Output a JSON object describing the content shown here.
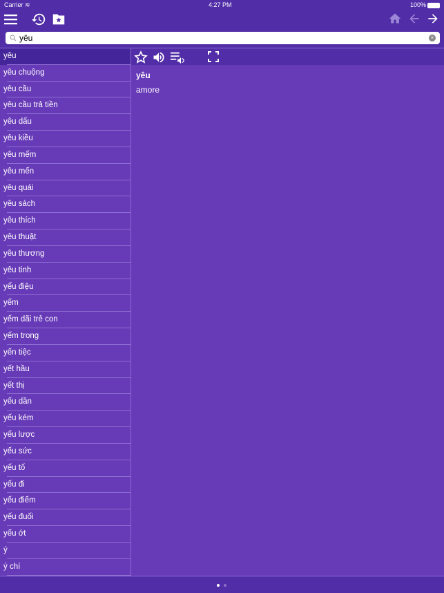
{
  "status": {
    "carrier": "Carrier",
    "time": "4:27 PM",
    "battery": "100%"
  },
  "search": {
    "value": "yêu"
  },
  "list": {
    "selected": "yêu",
    "items": [
      "yêu chuộng",
      "yêu cầu",
      "yêu cầu trả tiền",
      "yêu dấu",
      "yêu kiều",
      "yêu mếm",
      "yêu mến",
      "yêu quái",
      "yêu sách",
      "yêu thích",
      "yêu thuật",
      "yêu thương",
      "yêu tinh",
      "yểu điệu",
      "yếm",
      "yếm dãi trẻ con",
      "yếm trong",
      "yến tiệc",
      "yết hầu",
      "yết thị",
      "yếu dần",
      "yếu kém",
      "yếu lược",
      "yếu sức",
      "yếu tố",
      "yếu đi",
      "yếu điếm",
      "yếu đuối",
      "yếu ớt",
      "ý",
      "ý chí"
    ]
  },
  "entry": {
    "word": "yêu",
    "meaning": "amore"
  },
  "pager": {
    "pages": 2,
    "current": 1
  },
  "colors": {
    "bar": "#512da8",
    "list": "#673ab7",
    "selected": "#45259a"
  }
}
